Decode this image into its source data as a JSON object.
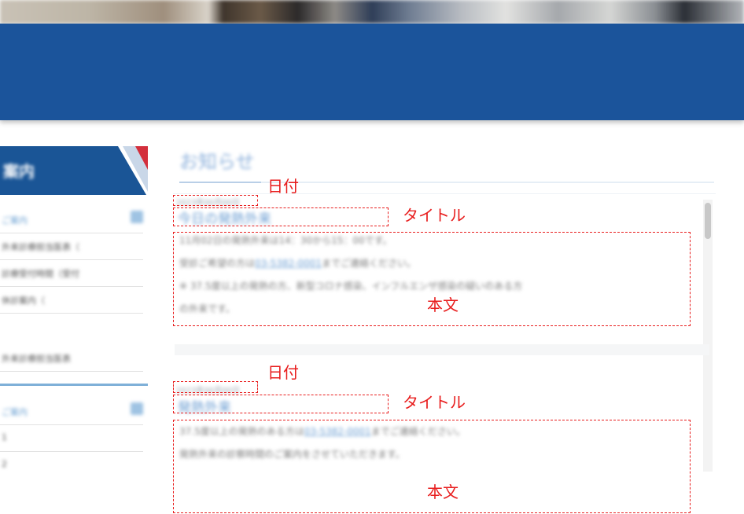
{
  "sidebar": {
    "tab_label": "案内",
    "section1_head": "ご案内",
    "items1": [
      "外来診療担当医表（",
      "診療受付時間（受付",
      "休診案内（"
    ],
    "item_plain": "外来診療担当医表",
    "section2_head": "ご案内",
    "items2": [
      "1",
      "2"
    ]
  },
  "main": {
    "page_title": "お知らせ"
  },
  "news": [
    {
      "date": "2023年00月00日",
      "title": "今日の発熱外来",
      "body": {
        "line1": "11月02日の発熱外来は14：30から15：00です。",
        "line2_prefix": "受診ご希望の方は",
        "phone": "03-5382-0001",
        "line2_suffix": "までご連絡ください。",
        "line3": "※ 37.5度以上の発熱の方、新型コロナ感染、インフルエンザ感染の疑いのある方",
        "line4": "の外来です。"
      }
    },
    {
      "date": "2023年00月00日",
      "title": "発熱外来",
      "body": {
        "line1_prefix": "37.5度以上の発熱のある方は",
        "phone": "03-5382-0001",
        "line1_suffix": "までご連絡ください。",
        "line2": "発熱外来の診察時間のご案内をさせていただきます。"
      }
    }
  ],
  "annotations": {
    "date": "日付",
    "title": "タイトル",
    "body": "本文"
  },
  "colors": {
    "header": "#1b549b",
    "accent_link": "#6d9fd3",
    "annotation": "#e81d1d"
  }
}
